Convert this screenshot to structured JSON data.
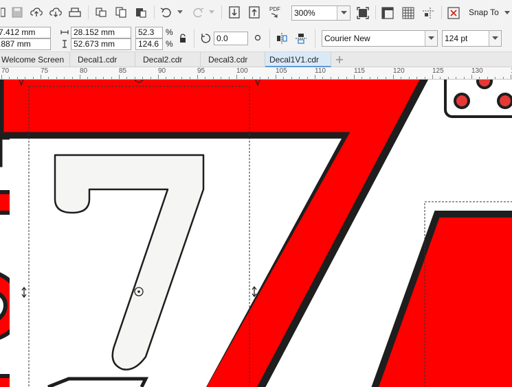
{
  "toolbar": {
    "zoom_value": "300%",
    "pdf_label": "PDF",
    "snap_label": "Snap To"
  },
  "property_bar": {
    "pos_x": "7.412 mm",
    "pos_y": ".887 mm",
    "width": "28.152 mm",
    "height": "52.673 mm",
    "scale_x": "52.3",
    "scale_y": "124.6",
    "scale_unit": "%",
    "rotation": "0.0",
    "font_name": "Courier New",
    "font_size": "124 pt"
  },
  "tabs": [
    {
      "label": "Welcome Screen",
      "active": false
    },
    {
      "label": "Decal1.cdr",
      "active": false
    },
    {
      "label": "Decal2.cdr",
      "active": false
    },
    {
      "label": "Decal3.cdr",
      "active": false
    },
    {
      "label": "Decal1V1.cdr",
      "active": true
    }
  ],
  "ruler": {
    "labels": [
      "70",
      "75",
      "80",
      "85",
      "90",
      "95",
      "100",
      "105",
      "110",
      "115",
      "120",
      "125",
      "130",
      "13"
    ]
  },
  "colors": {
    "decal_red": "#ff0000",
    "outline": "#1e1e1e",
    "digit_fill": "#f5f5f4",
    "active_tab": "#dbe9f7"
  }
}
